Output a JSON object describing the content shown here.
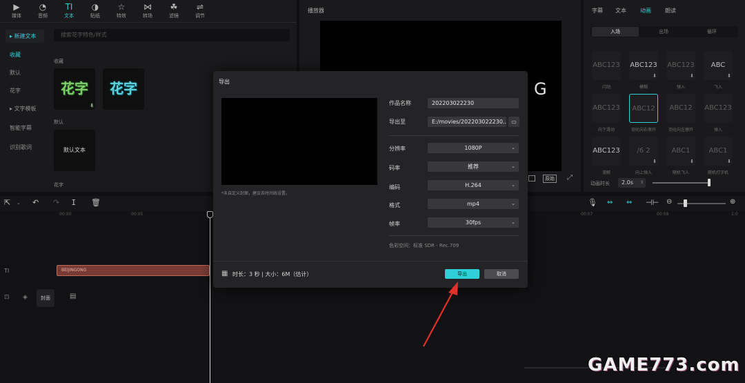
{
  "toolbar": {
    "items": [
      {
        "label": "媒体",
        "icon": "▶"
      },
      {
        "label": "音频",
        "icon": "◔"
      },
      {
        "label": "文本",
        "icon": "TI"
      },
      {
        "label": "贴纸",
        "icon": "◑"
      },
      {
        "label": "特效",
        "icon": "☆"
      },
      {
        "label": "转场",
        "icon": "⋈"
      },
      {
        "label": "滤镜",
        "icon": "☘"
      },
      {
        "label": "调节",
        "icon": "⇌"
      }
    ]
  },
  "left_sidebar": {
    "items": [
      "新建文本",
      "收藏",
      "默认",
      "花字",
      "文字模板",
      "智能字幕",
      "识别歌词"
    ]
  },
  "text_panel": {
    "search_placeholder": "搜索花字特色/样式",
    "section_collect": "收藏",
    "fancy_1": "花字",
    "fancy_2": "花字",
    "section_default": "默认",
    "default_text": "默认文本",
    "section_fancy": "花字"
  },
  "player": {
    "title": "播放器",
    "letter": "G",
    "btn_original": "原始",
    "fullscreen_icon": "⤢"
  },
  "right_panel": {
    "tabs": [
      "字幕",
      "文本",
      "动画",
      "朗读"
    ],
    "subtabs": [
      "入场",
      "出场",
      "循环"
    ],
    "tiles": [
      {
        "text": "ABC123",
        "label": "闪动"
      },
      {
        "text": "ABC123",
        "label": "模糊"
      },
      {
        "text": "ABC123",
        "label": "弹入"
      },
      {
        "text": "ABC",
        "label": "飞入"
      },
      {
        "text": "ABC123",
        "label": "向下滑动"
      },
      {
        "text": "ABC12",
        "label": "羽化向右擦开"
      },
      {
        "text": "ABC12",
        "label": "羽化向左擦开"
      },
      {
        "text": "ABC123",
        "label": "弹入"
      },
      {
        "text": "ABC123",
        "label": "溶解"
      },
      {
        "text": "/6 2",
        "label": "向上弹入"
      },
      {
        "text": "ABC1",
        "label": "随机飞入"
      },
      {
        "text": "ABC1",
        "label": "随机打字机"
      }
    ],
    "duration_label": "动画时长",
    "duration_value": "2.0s"
  },
  "timeline": {
    "tick_1": "00:00",
    "tick_2": "00:05",
    "tick_3": "00:07",
    "tick_4": "00:08",
    "tick_5": "1:0",
    "text_track_label": "TI",
    "clip_label": "BEIJINGONG",
    "cover_label": "封面"
  },
  "dialog": {
    "title": "导出",
    "cover_hint": "*未自定义封面，建议去时间线设置。",
    "name_label": "作品名称",
    "name_value": "202203022230",
    "path_label": "导出至",
    "path_value": "E:/movies/202203022230...",
    "resolution_label": "分辨率",
    "resolution_value": "1080P",
    "bitrate_label": "码率",
    "bitrate_value": "推荐",
    "codec_label": "编码",
    "codec_value": "H.264",
    "format_label": "格式",
    "format_value": "mp4",
    "fps_label": "帧率",
    "fps_value": "30fps",
    "colorspace": "色彩空间：标准 SDR - Rec.709",
    "summary": "时长：3 秒 | 大小：6M（估计）",
    "export_button": "导出",
    "cancel_button": "取消"
  },
  "watermark": "GAME773.com",
  "colors": {
    "accent": "#2fd0d8",
    "arrow": "#e0302a",
    "clip": "#7a3a34"
  }
}
